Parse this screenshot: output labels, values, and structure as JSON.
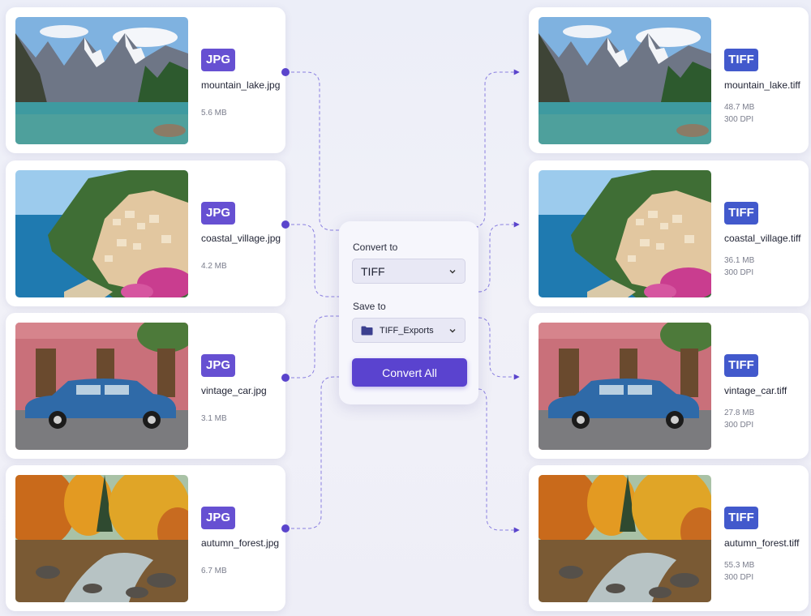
{
  "sources": [
    {
      "badge": "JPG",
      "filename": "mountain_lake.jpg",
      "size": "5.6 MB",
      "image": "mountain-lake"
    },
    {
      "badge": "JPG",
      "filename": "coastal_village.jpg",
      "size": "4.2 MB",
      "image": "coastal-village"
    },
    {
      "badge": "JPG",
      "filename": "vintage_car.jpg",
      "size": "3.1 MB",
      "image": "vintage-car"
    },
    {
      "badge": "JPG",
      "filename": "autumn_forest.jpg",
      "size": "6.7 MB",
      "image": "autumn-forest"
    }
  ],
  "outputs": [
    {
      "badge": "TIFF",
      "filename": "mountain_lake.tiff",
      "size": "48.7 MB",
      "dpi": "300 DPI",
      "image": "mountain-lake"
    },
    {
      "badge": "TIFF",
      "filename": "coastal_village.tiff",
      "size": "36.1 MB",
      "dpi": "300 DPI",
      "image": "coastal-village"
    },
    {
      "badge": "TIFF",
      "filename": "vintage_car.tiff",
      "size": "27.8 MB",
      "dpi": "300 DPI",
      "image": "vintage-car"
    },
    {
      "badge": "TIFF",
      "filename": "autumn_forest.tiff",
      "size": "55.3 MB",
      "dpi": "300 DPI",
      "image": "autumn-forest"
    }
  ],
  "panel": {
    "convert_to_label": "Convert to",
    "format_value": "TIFF",
    "save_to_label": "Save to",
    "folder_value": "TIFF_Exports",
    "folder_icon": "folder-icon",
    "dropdown_icon": "chevron-down-icon",
    "convert_button": "Convert All"
  },
  "colors": {
    "accent": "#5a43cf",
    "jpg_badge": "#6650d2",
    "tiff_badge": "#4259cc",
    "connector": "#6b5bd6"
  }
}
